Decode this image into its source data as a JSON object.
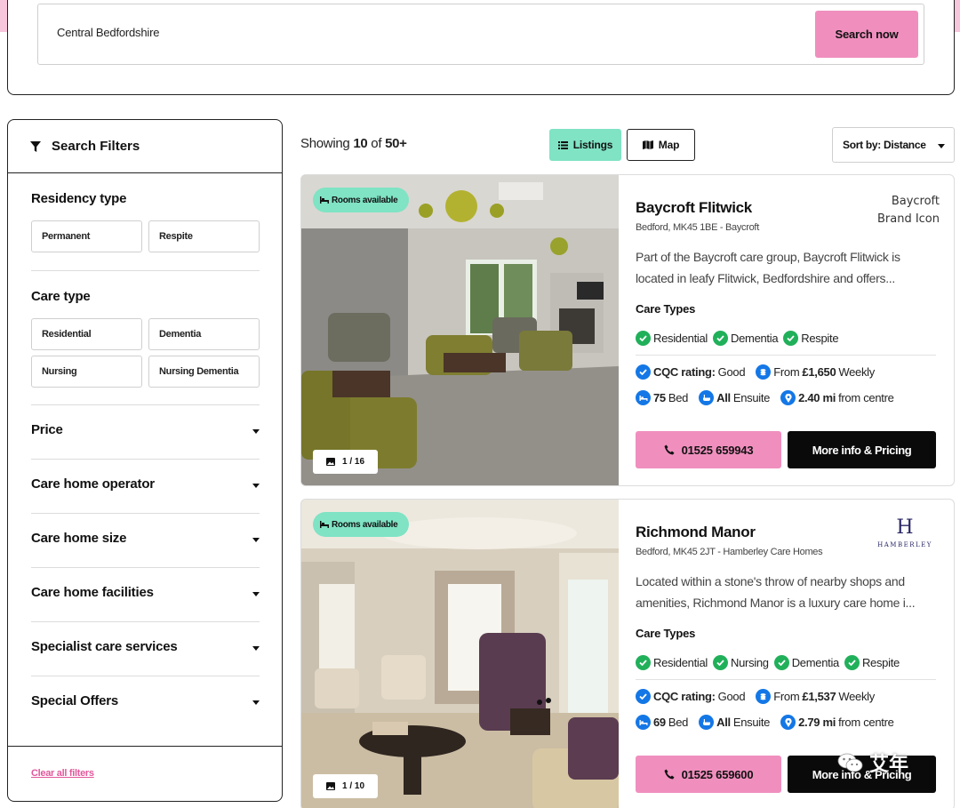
{
  "search": {
    "value": "Central Bedfordshire",
    "button_label": "Search now"
  },
  "filters": {
    "title": "Search Filters",
    "residency_type": {
      "title": "Residency type",
      "options": [
        "Permanent",
        "Respite"
      ]
    },
    "care_type": {
      "title": "Care type",
      "options": [
        "Residential",
        "Dementia",
        "Nursing",
        "Nursing Dementia"
      ]
    },
    "accordions": [
      "Price",
      "Care home operator",
      "Care home size",
      "Care home facilities",
      "Specialist care services",
      "Special Offers"
    ],
    "clear_label": "Clear all filters"
  },
  "results": {
    "showing_prefix": "Showing ",
    "shown": "10",
    "of": " of ",
    "total": "50+",
    "view_listings": "Listings",
    "view_map": "Map",
    "sort_label": "Sort by: Distance"
  },
  "listings": [
    {
      "badge": "Rooms available",
      "photo_count": "1 / 16",
      "name": "Baycroft Flitwick",
      "address": "Bedford, MK45 1BE - Baycroft",
      "brand_alt": "Baycroft Brand Icon",
      "description_lines": [
        "Part of the Baycroft care group, Baycroft Flitwick is",
        "located in leafy Flitwick, Bedfordshire and offers..."
      ],
      "care_types_title": "Care Types",
      "care_types": [
        "Residential",
        "Dementia",
        "Respite"
      ],
      "cqc_label": "CQC rating:",
      "cqc_value": "Good",
      "price_from": "From",
      "price": "£1,650",
      "price_period": "Weekly",
      "beds": "75",
      "beds_label": "Bed",
      "ensuite_strong": "All",
      "ensuite_label": "Ensuite",
      "distance": "2.40 mi",
      "distance_label": "from centre",
      "phone": "01525 659943",
      "more_label": "More info & Pricing"
    },
    {
      "badge": "Rooms available",
      "photo_count": "1 / 10",
      "name": "Richmond Manor",
      "address": "Bedford, MK45 2JT - Hamberley Care Homes",
      "brand_letter": "H",
      "brand_text": "HAMBERLEY",
      "description_lines": [
        "Located within a stone's throw of nearby shops and",
        "amenities, Richmond Manor is a luxury care home i..."
      ],
      "care_types_title": "Care Types",
      "care_types": [
        "Residential",
        "Nursing",
        "Dementia",
        "Respite"
      ],
      "cqc_label": "CQC rating:",
      "cqc_value": "Good",
      "price_from": "From",
      "price": "£1,537",
      "price_period": "Weekly",
      "beds": "69",
      "beds_label": "Bed",
      "ensuite_strong": "All",
      "ensuite_label": "Ensuite",
      "distance": "2.79 mi",
      "distance_label": "from centre",
      "phone": "01525 659600",
      "more_label": "More info & Pricing"
    }
  ],
  "watermark": "艾年",
  "colors": {
    "pink": "#f08fbe",
    "mint": "#7fe3c4",
    "check_green": "#21b05a",
    "info_blue": "#1477e6",
    "link_pink": "#e2589c"
  }
}
